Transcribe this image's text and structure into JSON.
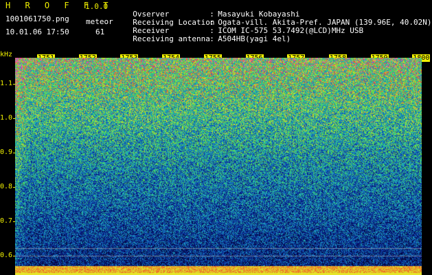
{
  "header": {
    "app_title": "H R O F F T",
    "app_version": "1.0.0",
    "file_name": "1001061750.png",
    "datetime": "10.01.06 17:50",
    "meteor_label": "meteor",
    "meteor_count": "61"
  },
  "info": [
    {
      "key": "Ovserver",
      "sep": ":",
      "value": "Masayuki Kobayashi"
    },
    {
      "key": "Receiving Location",
      "sep": ":",
      "value": "Ogata-vill. Akita-Pref. JAPAN (139.96E, 40.02N)"
    },
    {
      "key": "Receiver",
      "sep": ":",
      "value": "ICOM IC-575 53.7492(@LCD)MHz USB"
    },
    {
      "key": "Receiving antenna",
      "sep": ":",
      "value": "A504HB(yagi 4el)"
    }
  ],
  "plot": {
    "y_unit": "kHz",
    "y_ticks": [
      "1.1",
      "1.0",
      "0.9",
      "0.8",
      "0.7",
      "0.6"
    ],
    "x_ticks": [
      "1751",
      "1752",
      "1753",
      "1754",
      "1755",
      "1756",
      "1757",
      "1758",
      "1759",
      "1800"
    ],
    "colors": {
      "axis": "#f2f200",
      "background": "#000000"
    }
  }
}
